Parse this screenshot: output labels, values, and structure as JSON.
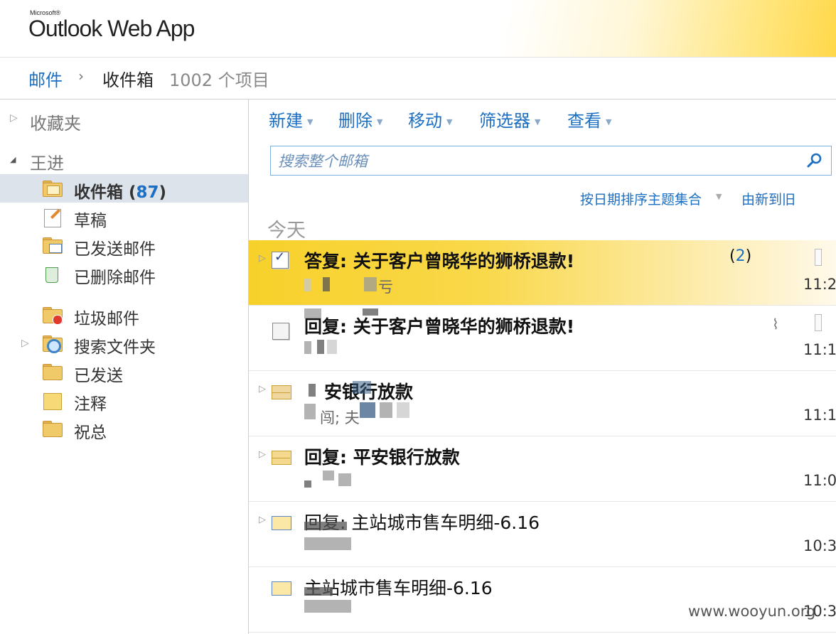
{
  "header": {
    "brand_small": "Microsoft®",
    "brand": "Outlook Web App"
  },
  "breadcrumb": {
    "mail": "邮件",
    "chevron": "›",
    "folder": "收件箱",
    "count": "1002 个项目"
  },
  "sidebar": {
    "favorites": "收藏夹",
    "account": "王进",
    "folders": [
      {
        "label": "收件箱",
        "count": "87"
      },
      {
        "label": "草稿"
      },
      {
        "label": "已发送邮件"
      },
      {
        "label": "已删除邮件"
      },
      {
        "label": "垃圾邮件"
      },
      {
        "label": "搜索文件夹"
      },
      {
        "label": "已发送"
      },
      {
        "label": "注释"
      },
      {
        "label": "祝总"
      }
    ]
  },
  "toolbar": {
    "new": "新建",
    "delete": "删除",
    "move": "移动",
    "filter": "筛选器",
    "view": "查看"
  },
  "search": {
    "placeholder": "搜索整个邮箱"
  },
  "sort": {
    "by": "按日期排序主题集合",
    "order": "由新到旧"
  },
  "group_label": "今天",
  "messages": [
    {
      "subject": "答复: 关于客户曾晓华的狮桥退款!",
      "sender": "亏",
      "count": "2",
      "time": "11:2"
    },
    {
      "subject": "回复: 关于客户曾晓华的狮桥退款!",
      "sender": "",
      "time": "11:1"
    },
    {
      "subject": "安银行放款",
      "sender": "闯;          夫",
      "time": "11:1"
    },
    {
      "subject": "回复:  平安银行放款",
      "sender": "",
      "time": "11:0"
    },
    {
      "subject": "回复:  主站城市售车明细-6.16",
      "sender": "",
      "time": "10:3"
    },
    {
      "subject": "主站城市售车明细-6.16",
      "sender": "",
      "time": "10:3"
    }
  ],
  "watermark": "www.wooyun.org"
}
